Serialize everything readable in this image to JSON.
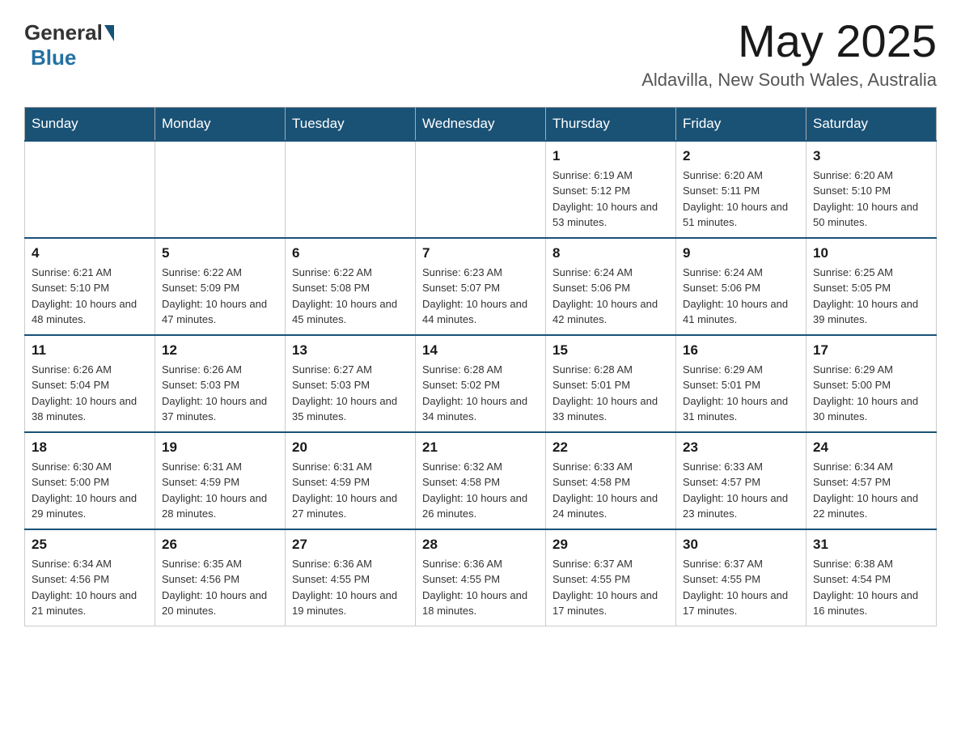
{
  "header": {
    "logo_general": "General",
    "logo_blue": "Blue",
    "month_title": "May 2025",
    "location": "Aldavilla, New South Wales, Australia"
  },
  "days_of_week": [
    "Sunday",
    "Monday",
    "Tuesday",
    "Wednesday",
    "Thursday",
    "Friday",
    "Saturday"
  ],
  "weeks": [
    {
      "days": [
        {
          "number": "",
          "info": ""
        },
        {
          "number": "",
          "info": ""
        },
        {
          "number": "",
          "info": ""
        },
        {
          "number": "",
          "info": ""
        },
        {
          "number": "1",
          "info": "Sunrise: 6:19 AM\nSunset: 5:12 PM\nDaylight: 10 hours and 53 minutes."
        },
        {
          "number": "2",
          "info": "Sunrise: 6:20 AM\nSunset: 5:11 PM\nDaylight: 10 hours and 51 minutes."
        },
        {
          "number": "3",
          "info": "Sunrise: 6:20 AM\nSunset: 5:10 PM\nDaylight: 10 hours and 50 minutes."
        }
      ]
    },
    {
      "days": [
        {
          "number": "4",
          "info": "Sunrise: 6:21 AM\nSunset: 5:10 PM\nDaylight: 10 hours and 48 minutes."
        },
        {
          "number": "5",
          "info": "Sunrise: 6:22 AM\nSunset: 5:09 PM\nDaylight: 10 hours and 47 minutes."
        },
        {
          "number": "6",
          "info": "Sunrise: 6:22 AM\nSunset: 5:08 PM\nDaylight: 10 hours and 45 minutes."
        },
        {
          "number": "7",
          "info": "Sunrise: 6:23 AM\nSunset: 5:07 PM\nDaylight: 10 hours and 44 minutes."
        },
        {
          "number": "8",
          "info": "Sunrise: 6:24 AM\nSunset: 5:06 PM\nDaylight: 10 hours and 42 minutes."
        },
        {
          "number": "9",
          "info": "Sunrise: 6:24 AM\nSunset: 5:06 PM\nDaylight: 10 hours and 41 minutes."
        },
        {
          "number": "10",
          "info": "Sunrise: 6:25 AM\nSunset: 5:05 PM\nDaylight: 10 hours and 39 minutes."
        }
      ]
    },
    {
      "days": [
        {
          "number": "11",
          "info": "Sunrise: 6:26 AM\nSunset: 5:04 PM\nDaylight: 10 hours and 38 minutes."
        },
        {
          "number": "12",
          "info": "Sunrise: 6:26 AM\nSunset: 5:03 PM\nDaylight: 10 hours and 37 minutes."
        },
        {
          "number": "13",
          "info": "Sunrise: 6:27 AM\nSunset: 5:03 PM\nDaylight: 10 hours and 35 minutes."
        },
        {
          "number": "14",
          "info": "Sunrise: 6:28 AM\nSunset: 5:02 PM\nDaylight: 10 hours and 34 minutes."
        },
        {
          "number": "15",
          "info": "Sunrise: 6:28 AM\nSunset: 5:01 PM\nDaylight: 10 hours and 33 minutes."
        },
        {
          "number": "16",
          "info": "Sunrise: 6:29 AM\nSunset: 5:01 PM\nDaylight: 10 hours and 31 minutes."
        },
        {
          "number": "17",
          "info": "Sunrise: 6:29 AM\nSunset: 5:00 PM\nDaylight: 10 hours and 30 minutes."
        }
      ]
    },
    {
      "days": [
        {
          "number": "18",
          "info": "Sunrise: 6:30 AM\nSunset: 5:00 PM\nDaylight: 10 hours and 29 minutes."
        },
        {
          "number": "19",
          "info": "Sunrise: 6:31 AM\nSunset: 4:59 PM\nDaylight: 10 hours and 28 minutes."
        },
        {
          "number": "20",
          "info": "Sunrise: 6:31 AM\nSunset: 4:59 PM\nDaylight: 10 hours and 27 minutes."
        },
        {
          "number": "21",
          "info": "Sunrise: 6:32 AM\nSunset: 4:58 PM\nDaylight: 10 hours and 26 minutes."
        },
        {
          "number": "22",
          "info": "Sunrise: 6:33 AM\nSunset: 4:58 PM\nDaylight: 10 hours and 24 minutes."
        },
        {
          "number": "23",
          "info": "Sunrise: 6:33 AM\nSunset: 4:57 PM\nDaylight: 10 hours and 23 minutes."
        },
        {
          "number": "24",
          "info": "Sunrise: 6:34 AM\nSunset: 4:57 PM\nDaylight: 10 hours and 22 minutes."
        }
      ]
    },
    {
      "days": [
        {
          "number": "25",
          "info": "Sunrise: 6:34 AM\nSunset: 4:56 PM\nDaylight: 10 hours and 21 minutes."
        },
        {
          "number": "26",
          "info": "Sunrise: 6:35 AM\nSunset: 4:56 PM\nDaylight: 10 hours and 20 minutes."
        },
        {
          "number": "27",
          "info": "Sunrise: 6:36 AM\nSunset: 4:55 PM\nDaylight: 10 hours and 19 minutes."
        },
        {
          "number": "28",
          "info": "Sunrise: 6:36 AM\nSunset: 4:55 PM\nDaylight: 10 hours and 18 minutes."
        },
        {
          "number": "29",
          "info": "Sunrise: 6:37 AM\nSunset: 4:55 PM\nDaylight: 10 hours and 17 minutes."
        },
        {
          "number": "30",
          "info": "Sunrise: 6:37 AM\nSunset: 4:55 PM\nDaylight: 10 hours and 17 minutes."
        },
        {
          "number": "31",
          "info": "Sunrise: 6:38 AM\nSunset: 4:54 PM\nDaylight: 10 hours and 16 minutes."
        }
      ]
    }
  ]
}
